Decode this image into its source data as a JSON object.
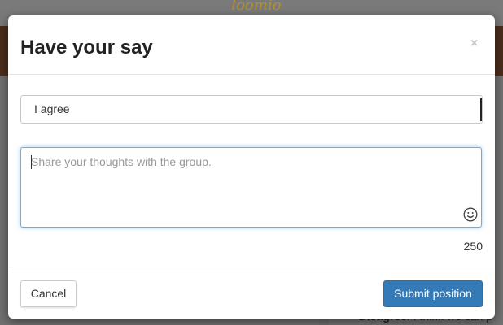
{
  "background": {
    "logo_text": "loomio",
    "bullet_label": "Disagree",
    "bullet_text": ": I think we can p"
  },
  "modal": {
    "title": "Have your say",
    "close_label": "×",
    "position_select": {
      "selected": "I agree"
    },
    "statement": {
      "placeholder": "Share your thoughts with the group.",
      "value": "",
      "chars_remaining": "250"
    },
    "cancel_label": "Cancel",
    "submit_label": "Submit position"
  },
  "colors": {
    "primary": "#337ab7",
    "focus_border": "#66afe9",
    "backdrop": "#6c6c6c"
  },
  "icons": {
    "emoji": "smiley-face-icon",
    "close": "close-icon"
  }
}
